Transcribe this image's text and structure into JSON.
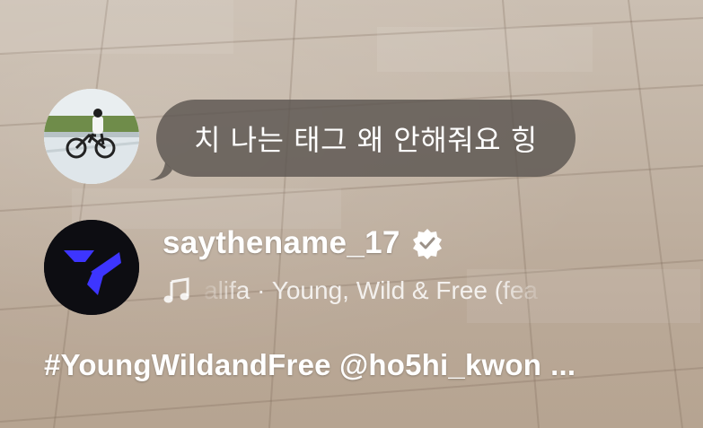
{
  "comment": {
    "text": "치 나는 태그 왜 안해줘요 힝"
  },
  "account": {
    "username": "saythename_17",
    "verified_icon": "verified-badge-icon",
    "music_icon": "music-note-icon",
    "track": "alifa · Young, Wild & Free (fea"
  },
  "caption": {
    "text": "#YoungWildandFree @ho5hi_kwon",
    "more": "..."
  },
  "colors": {
    "logo_accent": "#3d35ff",
    "bubble": "#5c5650",
    "text": "#ffffff"
  }
}
